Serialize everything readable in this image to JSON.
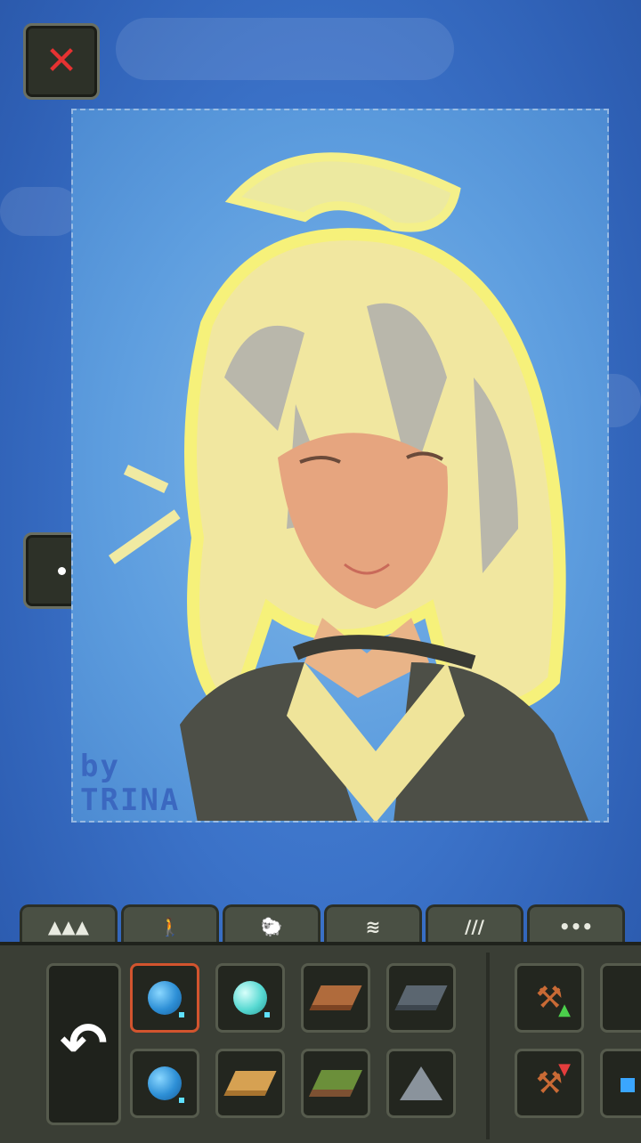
{
  "close_button": {
    "icon": "close-icon",
    "glyph": "✕",
    "color": "#e63232"
  },
  "side_button": {
    "icon": "dot-icon"
  },
  "artwork": {
    "signature_line1": "by",
    "signature_line2": "TRINA"
  },
  "tabs": [
    {
      "name": "terrain-tab",
      "icon": "mountains-icon",
      "glyph": "▲▲▲"
    },
    {
      "name": "creatures-tab",
      "icon": "person-icon",
      "glyph": "🚶"
    },
    {
      "name": "animals-tab",
      "icon": "sheep-icon",
      "glyph": "🐑"
    },
    {
      "name": "disasters-tab",
      "icon": "storm-icon",
      "glyph": "≋"
    },
    {
      "name": "tools-tab",
      "icon": "brushes-icon",
      "glyph": "∕∕∕"
    },
    {
      "name": "more-tab",
      "icon": "more-icon",
      "glyph": "•••"
    }
  ],
  "toolbar": {
    "undo_glyph": "↶",
    "tiles": [
      {
        "name": "deep-water-tile",
        "icon": "deep-water-orb-icon"
      },
      {
        "name": "shallow-water-tile",
        "icon": "shallow-water-orb-icon"
      },
      {
        "name": "soil-tile",
        "icon": "soil-slab-icon"
      },
      {
        "name": "stone-tile",
        "icon": "stone-slab-icon"
      },
      {
        "name": "water-orb-tile",
        "icon": "water-orb-icon"
      },
      {
        "name": "sand-tile",
        "icon": "sand-slab-icon"
      },
      {
        "name": "grass-tile",
        "icon": "grass-slab-icon"
      },
      {
        "name": "mountain-tile",
        "icon": "mountain-icon"
      }
    ],
    "right_tools": [
      {
        "name": "raise-terrain-tool",
        "icon": "shovel-up-icon"
      },
      {
        "name": "lower-terrain-tool",
        "icon": "shovel-down-icon"
      }
    ]
  }
}
